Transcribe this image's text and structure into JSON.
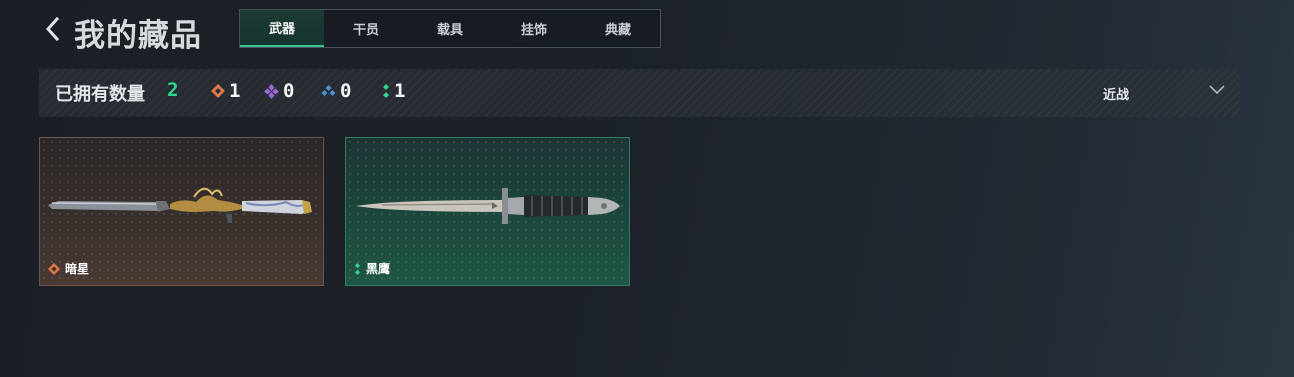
{
  "header": {
    "title": "我的藏品"
  },
  "tabs": [
    {
      "label": "武器",
      "active": true
    },
    {
      "label": "干员",
      "active": false
    },
    {
      "label": "载具",
      "active": false
    },
    {
      "label": "挂饰",
      "active": false
    },
    {
      "label": "典藏",
      "active": false
    }
  ],
  "stats": {
    "owned_label": "已拥有数量",
    "owned_count": "2",
    "rarities": [
      {
        "icon": "orange-diamond-icon",
        "color": "#e0784a",
        "count": "1"
      },
      {
        "icon": "purple-diamond-icon",
        "color": "#9a6ad8",
        "count": "0"
      },
      {
        "icon": "blue-diamond-icon",
        "color": "#4d8fd6",
        "count": "0"
      },
      {
        "icon": "green-dots-icon",
        "color": "#2fd58e",
        "count": "1"
      }
    ],
    "filter": {
      "value": "近战"
    }
  },
  "items": [
    {
      "name": "暗星",
      "rarity_icon": "orange-diamond-icon",
      "rarity_color": "#e0784a"
    },
    {
      "name": "黑鹰",
      "rarity_icon": "green-dots-icon",
      "rarity_color": "#2fd58e"
    }
  ],
  "colors": {
    "accent": "#32c48c",
    "owned_count": "#2fd58e"
  }
}
